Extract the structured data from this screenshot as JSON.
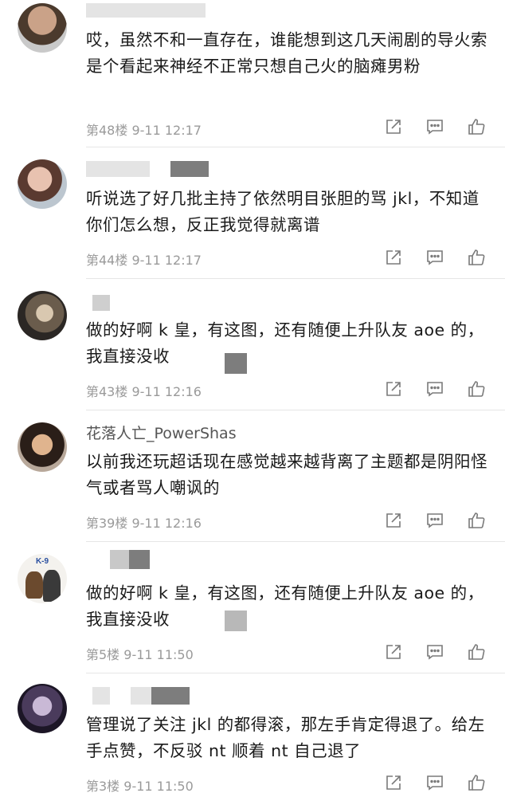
{
  "comments": [
    {
      "username": "",
      "text": "哎，虽然不和一直存在，谁能想到这几天闹剧的导火索是个看起来神经不正常只想自己火的脑瘫男粉",
      "floor": "第48楼",
      "time": "9-11 12:17"
    },
    {
      "username": "",
      "text": "听说选了好几批主持了依然明目张胆的骂 jkl，不知道你们怎么想，反正我觉得就离谱",
      "floor": "第44楼",
      "time": "9-11 12:17"
    },
    {
      "username": "",
      "text": "做的好啊 k 皇，有这图，还有随便上升队友 aoe 的，我直接没收",
      "floor": "第43楼",
      "time": "9-11 12:16"
    },
    {
      "username": "花落人亡_PowerShas",
      "text": "以前我还玩超话现在感觉越来越背离了主题都是阴阳怪气或者骂人嘲讽的",
      "floor": "第39楼",
      "time": "9-11 12:16"
    },
    {
      "username": "",
      "text": "做的好啊 k 皇，有这图，还有随便上升队友 aoe 的，我直接没收",
      "floor": "第5楼",
      "time": "9-11 11:50"
    },
    {
      "username": "",
      "text": "管理说了关注 jkl 的都得滚，那左手肯定得退了。给左手点赞，不反驳 nt 顺着 nt 自己退了",
      "floor": "第3楼",
      "time": "9-11 11:50"
    }
  ],
  "icons": {
    "share": "share-icon",
    "comment": "comment-icon",
    "like": "thumbs-up-icon"
  },
  "avatar_badge": "K-9"
}
